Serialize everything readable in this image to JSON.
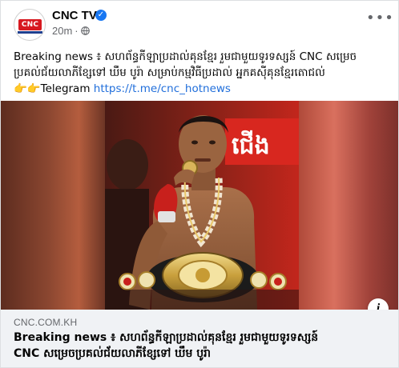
{
  "header": {
    "page_name": "CNC TV",
    "avatar_text": "CNC",
    "time": "20m",
    "separator": "·",
    "more_label": "•••"
  },
  "post": {
    "line1": "Breaking news ៖ សហព័ន្ធកីឡាប្រដាល់គុនខ្មែរ រួមជាមួយទូរទស្សន៍ CNC សម្រេច",
    "line2": "ប្រគល់ជ័យលាភីខ្សែទៅ ឃឹម បូរ៉ា សម្រាប់កម្មវិធីប្រដាល់ អ្នកគស៊ីគុនខ្មែរតោជល់",
    "emoji": "👉👉",
    "telegram_label": "Telegram ",
    "telegram_link": "https://t.me/cnc_hotnews"
  },
  "image": {
    "ring_text": "ជើង"
  },
  "link_preview": {
    "domain": "CNC.COM.KH",
    "title_line1": "Breaking news ៖ សហព័ន្ធកីឡាប្រដាល់គុនខ្មែរ រួមជាមួយទូរទស្សន៍",
    "title_line2": "CNC សម្រេចប្រគល់ជ័យលាភីខ្សែទៅ ឃឹម បូរ៉ា",
    "info_label": "i"
  },
  "colors": {
    "verified": "#1877f2",
    "link": "#216fdb",
    "brand_red": "#d71920"
  },
  "icons": [
    "verified-badge-icon",
    "globe-icon",
    "more-options-icon",
    "info-icon"
  ]
}
